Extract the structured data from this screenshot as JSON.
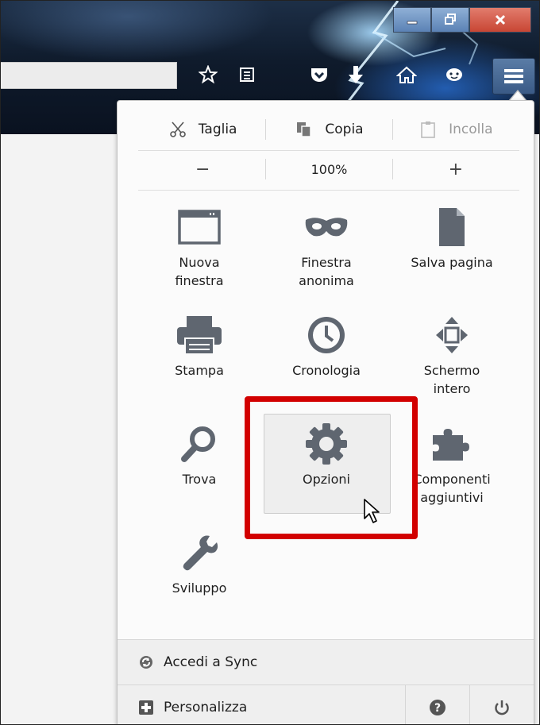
{
  "toolbar": {
    "icons": [
      "bookmark-star-icon",
      "reading-list-icon",
      "pocket-icon",
      "download-icon",
      "home-icon",
      "chat-icon",
      "hamburger-menu-icon"
    ]
  },
  "window_controls": [
    "minimize",
    "maximize",
    "close"
  ],
  "menu": {
    "edit": {
      "cut": "Taglia",
      "copy": "Copia",
      "paste": "Incolla"
    },
    "zoom": {
      "decrease": "−",
      "value": "100%",
      "increase": "+"
    },
    "items": [
      {
        "line1": "Nuova",
        "line2": "finestra",
        "icon": "new-window-icon"
      },
      {
        "line1": "Finestra",
        "line2": "anonima",
        "icon": "private-mask-icon"
      },
      {
        "line1": "Salva pagina",
        "line2": "",
        "icon": "save-page-icon"
      },
      {
        "line1": "Stampa",
        "line2": "",
        "icon": "printer-icon"
      },
      {
        "line1": "Cronologia",
        "line2": "",
        "icon": "history-clock-icon"
      },
      {
        "line1": "Schermo",
        "line2": "intero",
        "icon": "fullscreen-icon"
      },
      {
        "line1": "Trova",
        "line2": "",
        "icon": "search-icon"
      },
      {
        "line1": "Opzioni",
        "line2": "",
        "icon": "gear-icon"
      },
      {
        "line1": "Componenti",
        "line2": "aggiuntivi",
        "icon": "puzzle-icon"
      },
      {
        "line1": "Sviluppo",
        "line2": "",
        "icon": "wrench-icon"
      }
    ],
    "sync": "Accedi a Sync",
    "customize": "Personalizza"
  },
  "colors": {
    "highlight": "#d20000",
    "icon_gray": "#5f6670"
  }
}
